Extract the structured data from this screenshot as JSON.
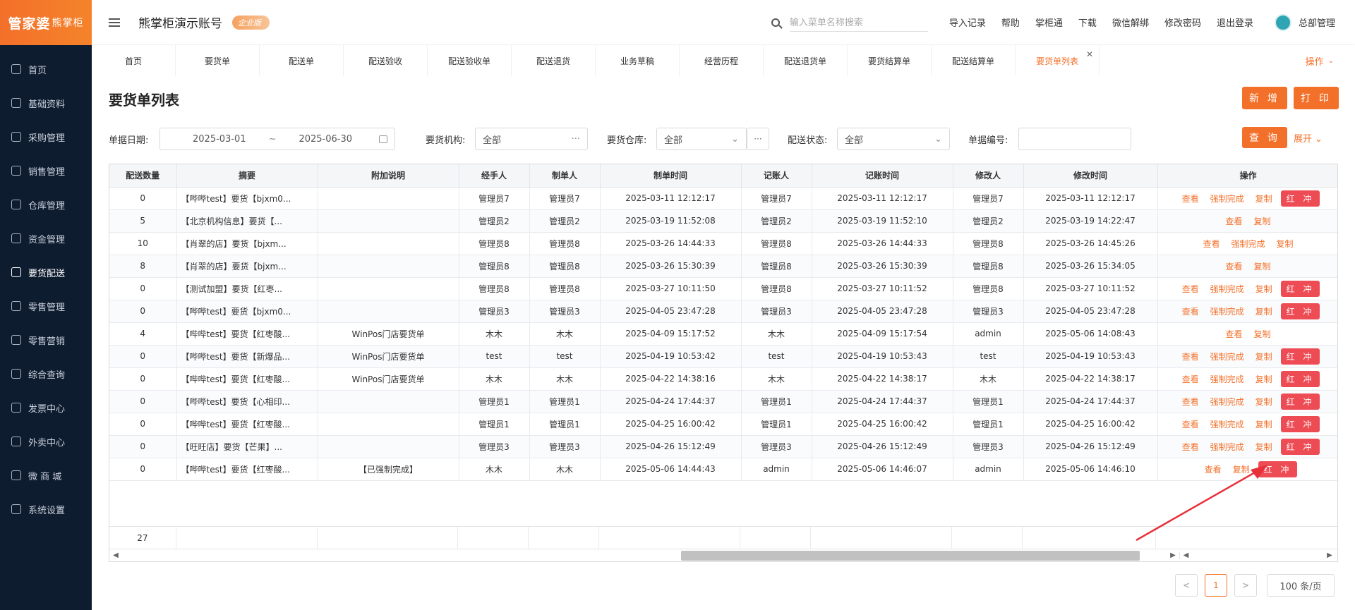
{
  "brand": {
    "logo_main": "管家婆",
    "logo_sub": "熊掌柜"
  },
  "sidebar": {
    "items": [
      {
        "label": "首页",
        "icon": "globe-icon"
      },
      {
        "label": "基础资料",
        "icon": "home-icon"
      },
      {
        "label": "采购管理",
        "icon": "cart-icon"
      },
      {
        "label": "销售管理",
        "icon": "sales-icon"
      },
      {
        "label": "仓库管理",
        "icon": "warehouse-icon"
      },
      {
        "label": "资金管理",
        "icon": "money-icon"
      },
      {
        "label": "要货配送",
        "icon": "delivery-icon",
        "active": true
      },
      {
        "label": "零售管理",
        "icon": "retail-icon"
      },
      {
        "label": "零售营销",
        "icon": "gift-icon"
      },
      {
        "label": "综合查询",
        "icon": "chart-icon"
      },
      {
        "label": "发票中心",
        "icon": "invoice-icon"
      },
      {
        "label": "外卖中心",
        "icon": "takeout-icon"
      },
      {
        "label": "微 商 城",
        "icon": "shop-icon"
      },
      {
        "label": "系统设置",
        "icon": "gear-icon"
      }
    ]
  },
  "header": {
    "account_name": "熊掌柜演示账号",
    "edition_badge": "企业版",
    "search_placeholder": "输入菜单名称搜索",
    "links": [
      "导入记录",
      "帮助",
      "掌柜通",
      "下载",
      "微信解绑",
      "修改密码",
      "退出登录"
    ],
    "user_name": "总部管理"
  },
  "tabs": {
    "items": [
      "首页",
      "要货单",
      "配送单",
      "配送验收",
      "配送验收单",
      "配送退货",
      "业务草稿",
      "经营历程",
      "配送退货单",
      "要货结算单",
      "配送结算单",
      "要货单列表"
    ],
    "active_index": 11,
    "ops_label": "操作"
  },
  "page": {
    "title": "要货单列表",
    "btn_new": "新 增",
    "btn_print": "打 印",
    "btn_query": "查 询",
    "expand_label": "展开"
  },
  "filters": {
    "date_label": "单据日期:",
    "date_start": "2025-03-01",
    "date_sep": "~",
    "date_end": "2025-06-30",
    "org_label": "要货机构:",
    "org_value": "全部",
    "warehouse_label": "要货仓库:",
    "warehouse_value": "全部",
    "status_label": "配送状态:",
    "status_value": "全部",
    "bill_no_label": "单据编号:",
    "bill_no_value": ""
  },
  "table": {
    "columns": [
      "配送数量",
      "摘要",
      "附加说明",
      "经手人",
      "制单人",
      "制单时间",
      "记账人",
      "记账时间",
      "修改人",
      "修改时间",
      "操作"
    ],
    "rows": [
      {
        "qty": "0",
        "summary": "【哔哔test】要货【bjxm0...",
        "note": "",
        "handler": "管理员7",
        "maker": "管理员7",
        "made_at": "2025-03-11 12:12:17",
        "poster": "管理员7",
        "posted_at": "2025-03-11 12:12:17",
        "modifier": "管理员7",
        "modified_at": "2025-03-11 12:12:17",
        "ops": [
          "查看",
          "强制完成",
          "复制",
          "红 冲"
        ]
      },
      {
        "qty": "5",
        "summary": "【北京机构信息】要货【...",
        "note": "",
        "handler": "管理员2",
        "maker": "管理员2",
        "made_at": "2025-03-19 11:52:08",
        "poster": "管理员2",
        "posted_at": "2025-03-19 11:52:10",
        "modifier": "管理员2",
        "modified_at": "2025-03-19 14:22:47",
        "ops": [
          "查看",
          "复制"
        ]
      },
      {
        "qty": "10",
        "summary": "【肖翠的店】要货【bjxm...",
        "note": "",
        "handler": "管理员8",
        "maker": "管理员8",
        "made_at": "2025-03-26 14:44:33",
        "poster": "管理员8",
        "posted_at": "2025-03-26 14:44:33",
        "modifier": "管理员8",
        "modified_at": "2025-03-26 14:45:26",
        "ops": [
          "查看",
          "强制完成",
          "复制"
        ]
      },
      {
        "qty": "8",
        "summary": "【肖翠的店】要货【bjxm...",
        "note": "",
        "handler": "管理员8",
        "maker": "管理员8",
        "made_at": "2025-03-26 15:30:39",
        "poster": "管理员8",
        "posted_at": "2025-03-26 15:30:39",
        "modifier": "管理员8",
        "modified_at": "2025-03-26 15:34:05",
        "ops": [
          "查看",
          "复制"
        ]
      },
      {
        "qty": "0",
        "summary": "【测试加盟】要货【红枣...",
        "note": "",
        "handler": "管理员8",
        "maker": "管理员8",
        "made_at": "2025-03-27 10:11:50",
        "poster": "管理员8",
        "posted_at": "2025-03-27 10:11:52",
        "modifier": "管理员8",
        "modified_at": "2025-03-27 10:11:52",
        "ops": [
          "查看",
          "强制完成",
          "复制",
          "红 冲"
        ]
      },
      {
        "qty": "0",
        "summary": "【哔哔test】要货【bjxm0...",
        "note": "",
        "handler": "管理员3",
        "maker": "管理员3",
        "made_at": "2025-04-05 23:47:28",
        "poster": "管理员3",
        "posted_at": "2025-04-05 23:47:28",
        "modifier": "管理员3",
        "modified_at": "2025-04-05 23:47:28",
        "ops": [
          "查看",
          "强制完成",
          "复制",
          "红 冲"
        ]
      },
      {
        "qty": "4",
        "summary": "【哔哔test】要货【红枣酸...",
        "note": "WinPos门店要货单",
        "handler": "木木",
        "maker": "木木",
        "made_at": "2025-04-09 15:17:52",
        "poster": "木木",
        "posted_at": "2025-04-09 15:17:54",
        "modifier": "admin",
        "modified_at": "2025-05-06 14:08:43",
        "ops": [
          "查看",
          "复制"
        ]
      },
      {
        "qty": "0",
        "summary": "【哔哔test】要货【新爆品...",
        "note": "WinPos门店要货单",
        "handler": "test",
        "maker": "test",
        "made_at": "2025-04-19 10:53:42",
        "poster": "test",
        "posted_at": "2025-04-19 10:53:43",
        "modifier": "test",
        "modified_at": "2025-04-19 10:53:43",
        "ops": [
          "查看",
          "强制完成",
          "复制",
          "红 冲"
        ]
      },
      {
        "qty": "0",
        "summary": "【哔哔test】要货【红枣酸...",
        "note": "WinPos门店要货单",
        "handler": "木木",
        "maker": "木木",
        "made_at": "2025-04-22 14:38:16",
        "poster": "木木",
        "posted_at": "2025-04-22 14:38:17",
        "modifier": "木木",
        "modified_at": "2025-04-22 14:38:17",
        "ops": [
          "查看",
          "强制完成",
          "复制",
          "红 冲"
        ]
      },
      {
        "qty": "0",
        "summary": "【哔哔test】要货【心相印...",
        "note": "",
        "handler": "管理员1",
        "maker": "管理员1",
        "made_at": "2025-04-24 17:44:37",
        "poster": "管理员1",
        "posted_at": "2025-04-24 17:44:37",
        "modifier": "管理员1",
        "modified_at": "2025-04-24 17:44:37",
        "ops": [
          "查看",
          "强制完成",
          "复制",
          "红 冲"
        ]
      },
      {
        "qty": "0",
        "summary": "【哔哔test】要货【红枣酸...",
        "note": "",
        "handler": "管理员1",
        "maker": "管理员1",
        "made_at": "2025-04-25 16:00:42",
        "poster": "管理员1",
        "posted_at": "2025-04-25 16:00:42",
        "modifier": "管理员1",
        "modified_at": "2025-04-25 16:00:42",
        "ops": [
          "查看",
          "强制完成",
          "复制",
          "红 冲"
        ]
      },
      {
        "qty": "0",
        "summary": "【旺旺店】要货【芒果】...",
        "note": "",
        "handler": "管理员3",
        "maker": "管理员3",
        "made_at": "2025-04-26 15:12:49",
        "poster": "管理员3",
        "posted_at": "2025-04-26 15:12:49",
        "modifier": "管理员3",
        "modified_at": "2025-04-26 15:12:49",
        "ops": [
          "查看",
          "强制完成",
          "复制",
          "红 冲"
        ]
      },
      {
        "qty": "0",
        "summary": "【哔哔test】要货【红枣酸...",
        "note": "【已强制完成】",
        "handler": "木木",
        "maker": "木木",
        "made_at": "2025-05-06 14:44:43",
        "poster": "admin",
        "posted_at": "2025-05-06 14:46:07",
        "modifier": "admin",
        "modified_at": "2025-05-06 14:46:10",
        "ops": [
          "查看",
          "复制",
          "红 冲"
        ]
      }
    ],
    "total_qty": "27"
  },
  "pagination": {
    "current_page": "1",
    "prev": "<",
    "next": ">",
    "page_size": "100 条/页"
  }
}
